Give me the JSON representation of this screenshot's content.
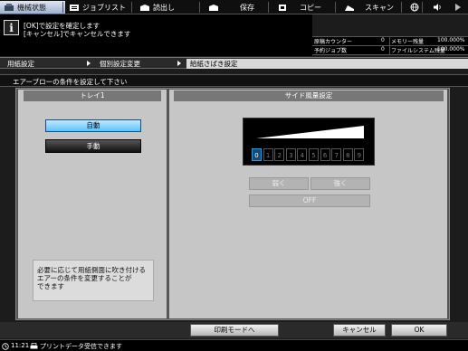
{
  "tabs": [
    {
      "label": "機械状態",
      "icon": "machine-status-icon",
      "active": true
    },
    {
      "label": "ジョブリスト",
      "icon": "job-list-icon"
    },
    {
      "label": "読出し",
      "icon": "read-box-icon"
    },
    {
      "label": "保存",
      "icon": "save-box-icon"
    },
    {
      "label": "コピー",
      "icon": "copy-icon"
    },
    {
      "label": "スキャン",
      "icon": "scan-icon"
    }
  ],
  "message": {
    "line1": "[OK]で設定を確定します",
    "line2": "[キャンセル]でキャンセルできます"
  },
  "counters": {
    "original_label": "原稿カウンター",
    "original_value": "0",
    "memory_label": "メモリー残量",
    "memory_value": "100.000%",
    "copies_label": "予約ジョブ数",
    "copies_value": "0",
    "filesystem_label": "ファイルシステム残量",
    "filesystem_value": "100.000%"
  },
  "breadcrumb": [
    "用紙設定",
    "個別設定変更",
    "給紙さばき設定"
  ],
  "instruction": "エアーブローの条件を設定して下さい",
  "left_panel": {
    "title": "トレイ1",
    "auto_label": "自動",
    "manual_label": "手動",
    "note_lines": [
      "必要に応じて用紙側面に吹き付ける",
      "エアーの条件を変更することが",
      "できます"
    ]
  },
  "right_panel": {
    "title": "サイド風量設定",
    "levels": [
      "0",
      "1",
      "2",
      "3",
      "4",
      "5",
      "6",
      "7",
      "8",
      "9"
    ],
    "selected_level": 0,
    "weak_label": "弱く",
    "strong_label": "強く",
    "off_label": "OFF"
  },
  "bottom": {
    "print_mode_label": "印刷モードへ",
    "cancel_label": "キャンセル",
    "ok_label": "OK"
  },
  "status": {
    "time": "11:21",
    "message": "プリントデータ受信できます"
  },
  "colors": {
    "accent_blue": "#5cc2ff",
    "panel_grey": "#c6c6c6",
    "header_grey": "#777777"
  }
}
